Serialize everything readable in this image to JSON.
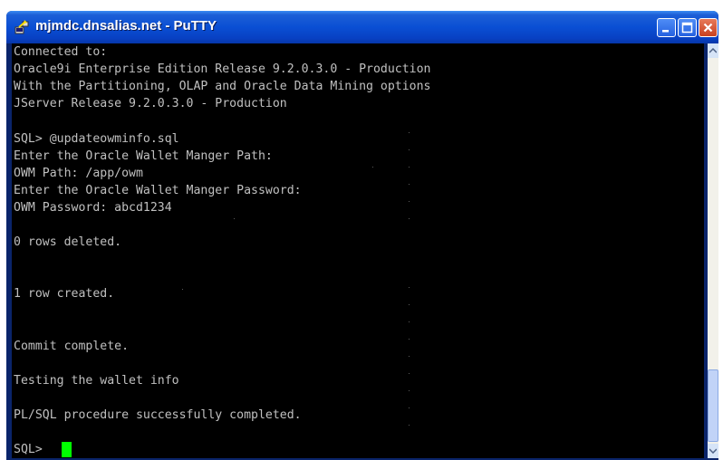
{
  "window": {
    "title": "mjmdc.dnsalias.net - PuTTY"
  },
  "icons": {
    "app": "putty-icon",
    "minimize": "minimize-icon",
    "maximize": "maximize-icon",
    "close": "close-icon"
  },
  "colors": {
    "terminal_background": "#000000",
    "terminal_text": "#C0C0C0",
    "cursor": "#00FF00",
    "titlebar": "#0A4FD4",
    "close_button": "#C8401F"
  },
  "terminal": {
    "lines": [
      "Connected to:",
      "Oracle9i Enterprise Edition Release 9.2.0.3.0 - Production",
      "With the Partitioning, OLAP and Oracle Data Mining options",
      "JServer Release 9.2.0.3.0 - Production",
      "",
      "SQL> @updateowminfo.sql",
      "Enter the Oracle Wallet Manger Path:",
      "OWM Path: /app/owm",
      "Enter the Oracle Wallet Manger Password:",
      "OWM Password: abcd1234",
      "",
      "0 rows deleted.",
      "",
      "",
      "1 row created.",
      "",
      "",
      "Commit complete.",
      "",
      "Testing the wallet info",
      "",
      "PL/SQL procedure successfully completed.",
      "",
      "SQL> "
    ]
  }
}
